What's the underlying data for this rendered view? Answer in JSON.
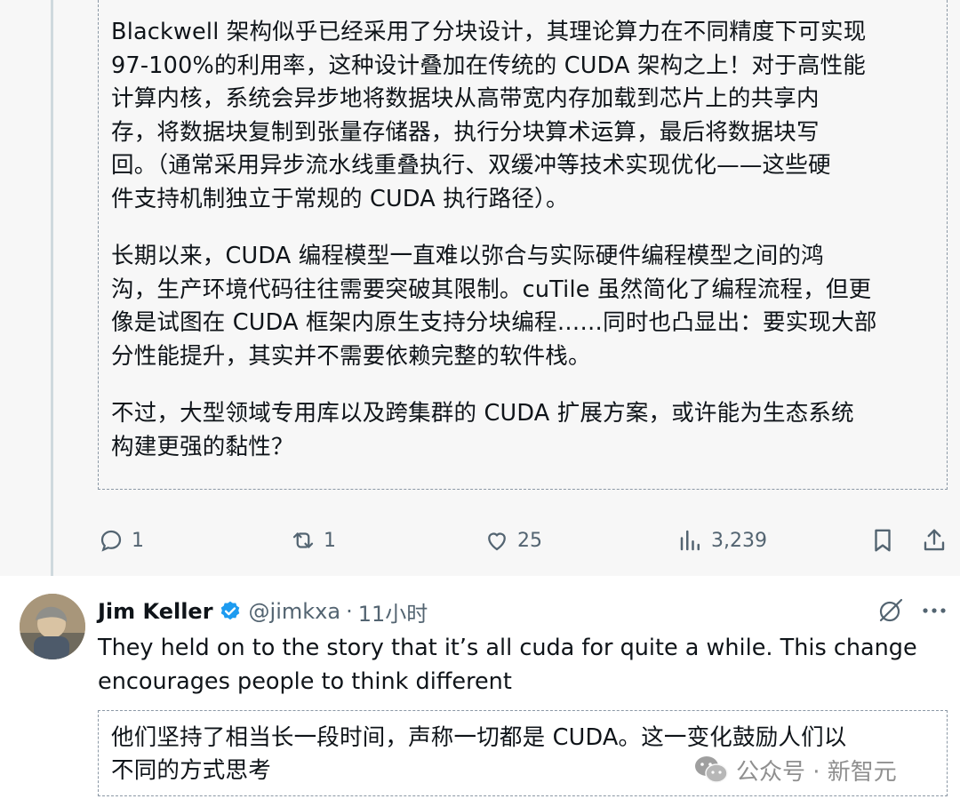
{
  "tweet": {
    "translation_paragraphs": [
      "Blackwell 架构似乎已经采用了分块设计，其理论算力在不同精度下可实现\n97-100%的利用率，这种设计叠加在传统的 CUDA 架构之上！对于高性能\n计算内核，系统会异步地将数据块从高带宽内存加载到芯片上的共享内\n存，将数据块复制到张量存储器，执行分块算术运算，最后将数据块写\n回。（通常采用异步流水线重叠执行、双缓冲等技术实现优化——这些硬\n件支持机制独立于常规的 CUDA 执行路径）。",
      "长期以来，CUDA 编程模型一直难以弥合与实际硬件编程模型之间的鸿\n沟，生产环境代码往往需要突破其限制。cuTile 虽然简化了编程流程，但更\n像是试图在 CUDA 框架内原生支持分块编程……同时也凸显出：要实现大部\n分性能提升，其实并不需要依赖完整的软件栈。",
      "不过，大型领域专用库以及跨集群的 CUDA 扩展方案，或许能为生态系统\n构建更强的黏性？"
    ],
    "actions": {
      "replies": "1",
      "reposts": "1",
      "likes": "25",
      "views": "3,239"
    }
  },
  "reply": {
    "display_name": "Jim Keller",
    "handle": "@jimkxa",
    "separator": "·",
    "time": "11小时",
    "text": "They held on to the story that it’s all cuda for quite a while. This change\nencourages people to think different",
    "translation": "他们坚持了相当长一段时间，声称一切都是 CUDA。这一变化鼓励人们以\n不同的方式思考"
  },
  "watermark": {
    "text": "公众号 · 新智元"
  },
  "colors": {
    "verified_blue": "#1d9bf0",
    "muted_text": "#536471",
    "thread_line": "#cfd9de"
  }
}
